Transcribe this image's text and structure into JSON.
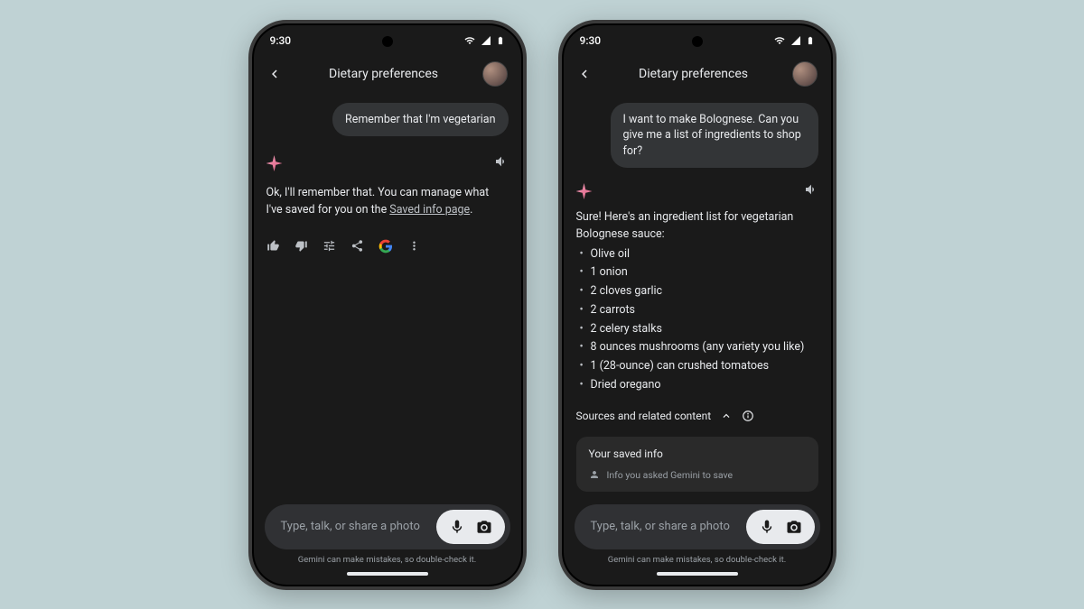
{
  "status": {
    "time": "9:30"
  },
  "header": {
    "title": "Dietary preferences"
  },
  "input": {
    "placeholder": "Type, talk, or share a photo",
    "disclaimer": "Gemini can make mistakes, so double-check it."
  },
  "phone1": {
    "user_msg": "Remember that I'm vegetarian",
    "ai_text_pre": "Ok, I'll remember that. You can manage what I've saved for you on the ",
    "ai_link": "Saved info page",
    "ai_text_post": "."
  },
  "phone2": {
    "user_msg": "I want to make Bolognese. Can you give me a list of ingredients to shop for?",
    "ai_intro": "Sure! Here's an ingredient list for vegetarian Bolognese sauce:",
    "ingredients": [
      "Olive oil",
      "1 onion",
      "2 cloves garlic",
      "2 carrots",
      "2 celery stalks",
      "8 ounces mushrooms (any variety you like)",
      "1 (28-ounce) can crushed tomatoes",
      "Dried oregano"
    ],
    "sources_label": "Sources and related content",
    "saved_title": "Your saved info",
    "saved_sub": "Info you asked Gemini to save"
  }
}
